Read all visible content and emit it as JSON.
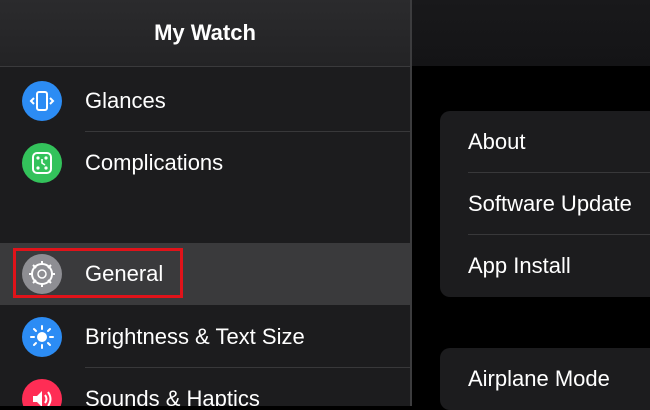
{
  "app": {
    "title": "My Watch"
  },
  "sidebar": {
    "items": [
      {
        "label": "Glances",
        "icon": "glances-icon",
        "color": "#2c8cf4"
      },
      {
        "label": "Complications",
        "icon": "complications-icon",
        "color": "#33c25b"
      },
      {
        "label": "General",
        "icon": "gear-icon",
        "color": "#8e8e93",
        "selected": true
      },
      {
        "label": "Brightness & Text Size",
        "icon": "brightness-icon",
        "color": "#2c8cf4"
      },
      {
        "label": "Sounds & Haptics",
        "icon": "speaker-icon",
        "color": "#ff2d55"
      }
    ]
  },
  "general": {
    "group1": [
      "About",
      "Software Update",
      "App Install"
    ],
    "group2": [
      "Airplane Mode"
    ]
  },
  "colors": {
    "highlight": "#e0131a"
  }
}
